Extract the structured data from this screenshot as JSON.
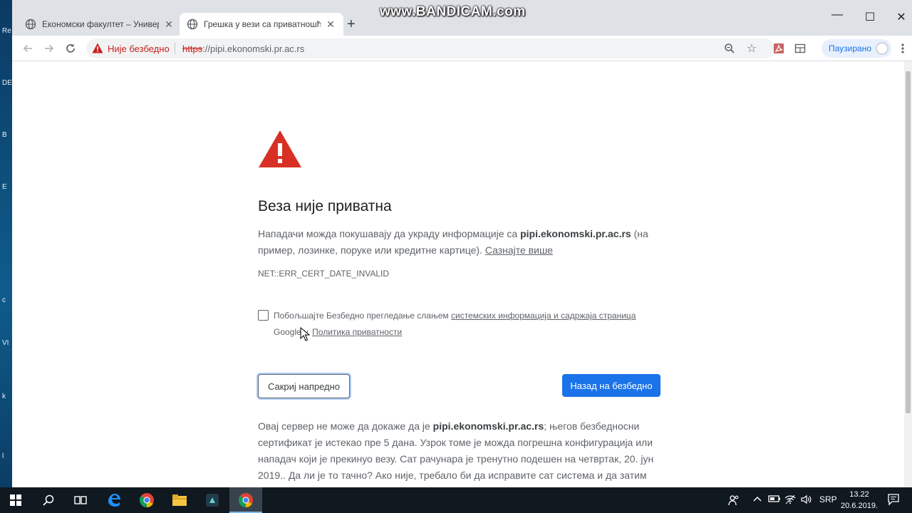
{
  "desktop": {
    "labels": [
      "Re",
      "DE",
      "B",
      "E",
      "c",
      "VI",
      "k",
      "l"
    ]
  },
  "watermark": "www.BANDICAM.com",
  "tabs": [
    {
      "title": "Економски факултет – Универзи",
      "active": false
    },
    {
      "title": "Грешка у вези са приватношћу",
      "active": true
    }
  ],
  "window_controls": {
    "minimize": "—",
    "maximize": "☐",
    "close": "✕"
  },
  "toolbar": {
    "security_label": "Није безбедно",
    "url_scheme": "https",
    "url_rest": "://pipi.ekonomski.pr.ac.rs",
    "profile_label": "Паузирано"
  },
  "error_page": {
    "heading": "Веза није приватна",
    "intro_before": "Нападачи можда покушавају да украду информације са ",
    "domain": "pipi.ekonomski.pr.ac.rs",
    "intro_after": " (на пример, лозинке, поруке или кредитне картице). ",
    "learn_more": "Сазнајте више",
    "error_code": "NET::ERR_CERT_DATE_INVALID",
    "checkbox_before": "Побољшајте Безбедно прегледање слањем ",
    "checkbox_link": "системских информација и садржаја страница",
    "checkbox_middle": " Google-у. ",
    "privacy_link": "Политика приватности",
    "advanced_button": "Сакриј напредно",
    "back_button": "Назад на безбедно",
    "details_before": "Овај сервер не може да докаже да је ",
    "details_domain": "pipi.ekonomski.pr.ac.rs",
    "details_after": "; његов безбедносни сертификат је истекао пре 5 дана. Узрок томе је можда погрешна конфигурација или нападач који је прекинуо везу. Сат рачунара је тренутно подешен на четвртак, 20. јун 2019.. Да ли је то тачно? Ако није, требало би да исправите сат система и да затим"
  },
  "taskbar": {
    "language": "SRP",
    "time": "13.22",
    "date": "20.6.2019."
  },
  "colors": {
    "danger": "#c5221f",
    "primary": "#1a73e8",
    "warning_triangle": "#d93025"
  },
  "icons": [
    "back-arrow-icon",
    "forward-arrow-icon",
    "reload-icon",
    "warning-icon",
    "zoom-icon",
    "star-icon",
    "pdf-icon",
    "extension-icon",
    "menu-icon",
    "windows-start-icon",
    "search-icon",
    "task-view-icon",
    "edge-icon",
    "chrome-icon",
    "file-explorer-icon",
    "filmora-icon"
  ]
}
